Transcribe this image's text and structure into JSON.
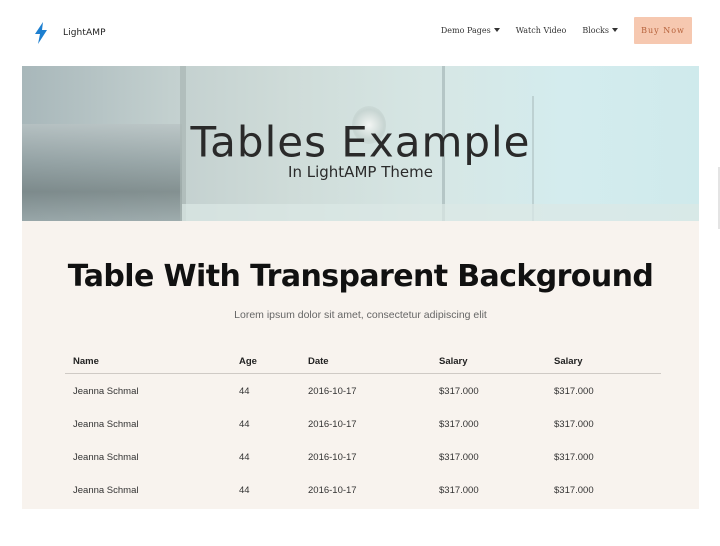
{
  "navbar": {
    "brand": "LightAMP",
    "brand_icon": "lightning-bolt-icon",
    "brand_color": "#1d7fd0",
    "items": [
      {
        "label": "Demo Pages",
        "has_dropdown": true
      },
      {
        "label": "Watch Video",
        "has_dropdown": false
      },
      {
        "label": "Blocks",
        "has_dropdown": true
      }
    ],
    "cta": {
      "label": "Buy Now",
      "bg_color": "#f6c8b0",
      "text_color": "#b6613a"
    }
  },
  "hero": {
    "title": "Tables Example",
    "subtitle": "In LightAMP Theme"
  },
  "section": {
    "title": "Table With Transparent Background",
    "subtitle": "Lorem ipsum dolor sit amet, consectetur adipiscing elit",
    "bg_color": "#f8f3ee"
  },
  "table": {
    "headers": [
      "Name",
      "Age",
      "Date",
      "Salary",
      "Salary"
    ],
    "rows": [
      [
        "Jeanna Schmal",
        "44",
        "2016-10-17",
        "$317.000",
        "$317.000"
      ],
      [
        "Jeanna Schmal",
        "44",
        "2016-10-17",
        "$317.000",
        "$317.000"
      ],
      [
        "Jeanna Schmal",
        "44",
        "2016-10-17",
        "$317.000",
        "$317.000"
      ],
      [
        "Jeanna Schmal",
        "44",
        "2016-10-17",
        "$317.000",
        "$317.000"
      ]
    ]
  }
}
